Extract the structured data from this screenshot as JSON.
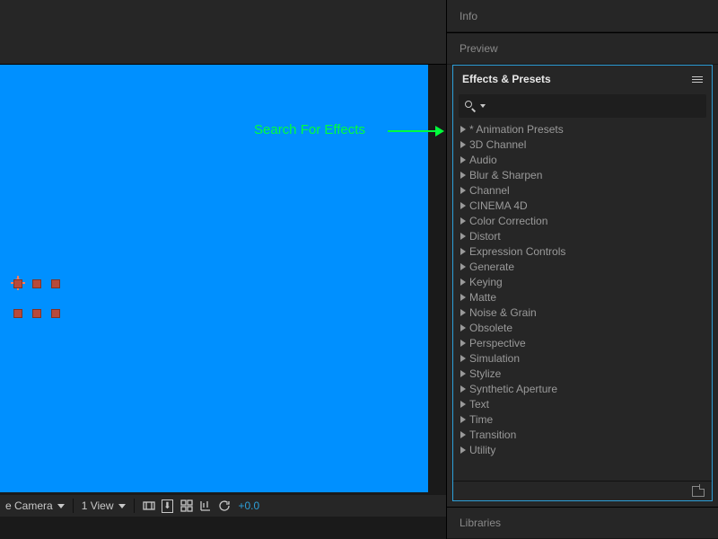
{
  "annotation": {
    "label": "Search For Effects"
  },
  "panels": {
    "info": "Info",
    "preview": "Preview",
    "effects_title": "Effects & Presets",
    "libraries": "Libraries"
  },
  "search": {
    "placeholder": ""
  },
  "categories": [
    "* Animation Presets",
    "3D Channel",
    "Audio",
    "Blur & Sharpen",
    "Channel",
    "CINEMA 4D",
    "Color Correction",
    "Distort",
    "Expression Controls",
    "Generate",
    "Keying",
    "Matte",
    "Noise & Grain",
    "Obsolete",
    "Perspective",
    "Simulation",
    "Stylize",
    "Synthetic Aperture",
    "Text",
    "Time",
    "Transition",
    "Utility"
  ],
  "viewer_bottom": {
    "camera": "e Camera",
    "views": "1 View",
    "exposure": "+0.0"
  }
}
